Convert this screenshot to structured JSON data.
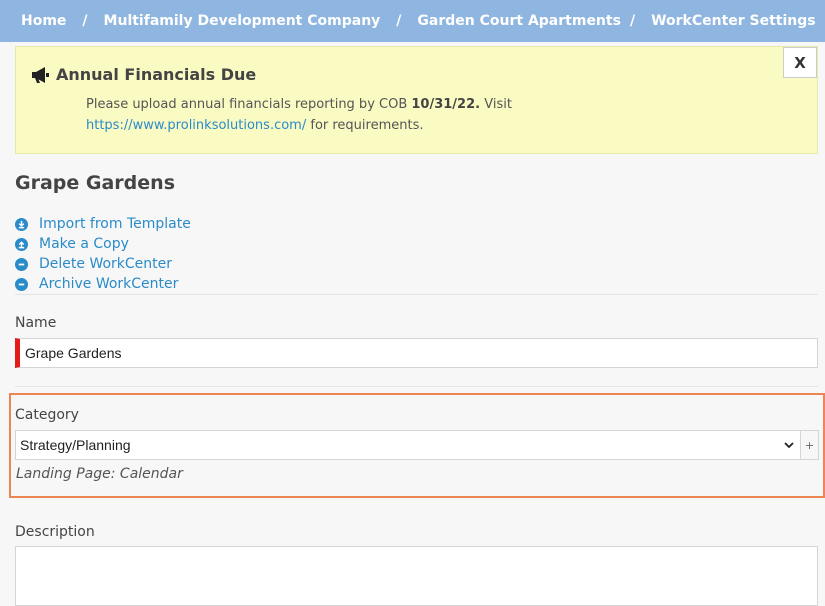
{
  "breadcrumb": {
    "items": [
      "Home",
      "Multifamily Development Company",
      "Garden Court Apartments",
      "WorkCenter Settings"
    ],
    "separator": "/"
  },
  "alert": {
    "title": "Annual Financials Due",
    "message_pre": "Please upload annual financials reporting by COB ",
    "deadline": "10/31/22.",
    "message_mid": " Visit ",
    "link": "https://www.prolinksolutions.com/",
    "message_post": " for requirements.",
    "close_label": "X",
    "icon": "megaphone-icon"
  },
  "page": {
    "title": "Grape Gardens"
  },
  "actions": [
    {
      "label": "Import from Template",
      "icon": "cloud-download-icon"
    },
    {
      "label": "Make a Copy",
      "icon": "cloud-upload-icon"
    },
    {
      "label": "Delete WorkCenter",
      "icon": "minus-circle-icon"
    },
    {
      "label": "Archive WorkCenter",
      "icon": "minus-circle-icon"
    }
  ],
  "form": {
    "name_label": "Name",
    "name_value": "Grape Gardens",
    "category_label": "Category",
    "category_value": "Strategy/Planning",
    "category_add": "+",
    "landing_page": "Landing Page: Calendar",
    "description_label": "Description",
    "description_value": ""
  },
  "colors": {
    "breadcrumb_bg": "#8fb6e0",
    "alert_bg": "#fafac3",
    "link": "#2a8bc9",
    "required_marker": "#e31b1b",
    "highlight": "#ee8654"
  }
}
